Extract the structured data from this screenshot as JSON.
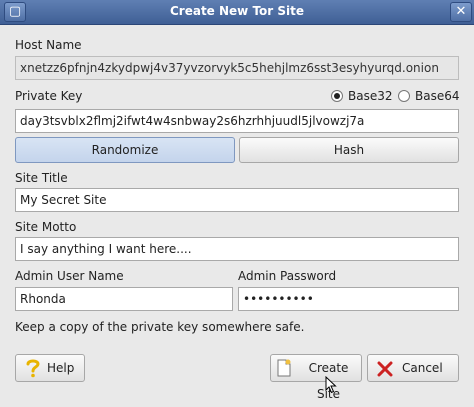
{
  "window": {
    "title": "Create New Tor Site"
  },
  "host_name": {
    "label": "Host Name",
    "value": "xnetzz6pfnjn4zkydpwj4v37yvzorvyk5c5hehjlmz6sst3esyhyurqd.onion"
  },
  "private_key": {
    "label": "Private Key",
    "value": "day3tsvblx2flmj2ifwt4w4snbway2s6hzrhhjuudl5jlvowzj7a",
    "options": [
      {
        "label": "Base32",
        "selected": true
      },
      {
        "label": "Base64",
        "selected": false
      }
    ]
  },
  "buttons": {
    "randomize": "Randomize",
    "hash": "Hash",
    "help": "Help",
    "create": "Create Site",
    "cancel": "Cancel"
  },
  "site_title": {
    "label": "Site Title",
    "value": "My Secret Site"
  },
  "site_motto": {
    "label": "Site Motto",
    "value": "I say anything I want here...."
  },
  "admin_user": {
    "label": "Admin User Name",
    "value": "Rhonda"
  },
  "admin_password": {
    "label": "Admin Password",
    "value": "••••••••••"
  },
  "note": "Keep a copy of the private key somewhere safe.",
  "colors": {
    "titlebar": "#4a6aa0",
    "window_bg": "#e9e9e9",
    "cancel_x": "#cc2222",
    "help_icon": "#e8b400"
  }
}
